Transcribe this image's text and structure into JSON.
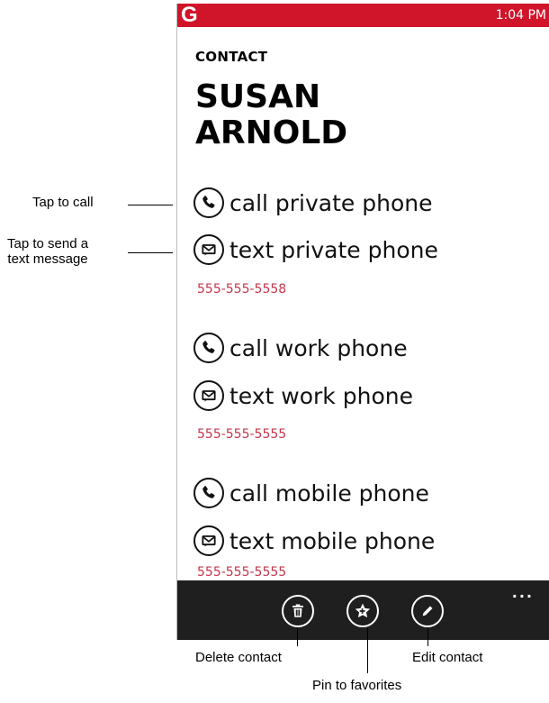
{
  "status_bar": {
    "logo": "G",
    "time": "1:04 PM"
  },
  "header": {
    "app_title": "CONTACT",
    "name_line1": "SUSAN",
    "name_line2": "ARNOLD"
  },
  "groups": [
    {
      "call_label": "call private phone",
      "text_label": "text private phone",
      "number": "555-555-5558"
    },
    {
      "call_label": "call work phone",
      "text_label": "text work phone",
      "number": "555-555-5555"
    },
    {
      "call_label": "call mobile phone",
      "text_label": "text mobile phone",
      "number": "555-555-5555"
    }
  ],
  "app_bar": {
    "more": "..."
  },
  "callouts": {
    "tap_to_call": "Tap to call",
    "tap_to_text_line1": "Tap to send a",
    "tap_to_text_line2": "text message",
    "delete": "Delete contact",
    "pin": "Pin to favorites",
    "edit": "Edit contact"
  },
  "colors": {
    "status_bar": "#d0142a",
    "number": "#c4364b",
    "app_bar": "#1f1f1f"
  }
}
